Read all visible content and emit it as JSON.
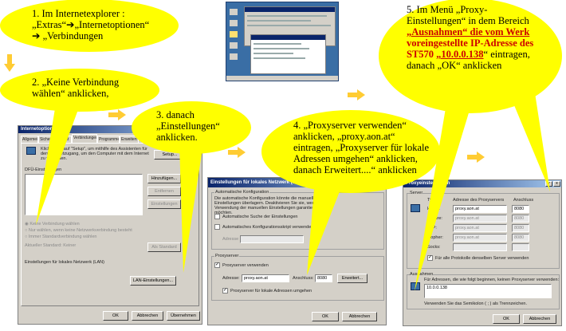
{
  "step1": {
    "line1": "1. Im Internetexplorer :",
    "line2": "„Extras“➔„Internetoptionen“",
    "line3": "➔ „Verbindungen"
  },
  "step2": {
    "line1": "2. „Keine Verbindung",
    "line2": "wählen“ anklicken,"
  },
  "step3": {
    "line1": "3. danach",
    "line2": "„Einstellungen“",
    "line3": "anklicken."
  },
  "step4": {
    "line1": "4. „Proxyserver verwenden“",
    "line2": "anklicken, „proxy.aon.at“",
    "line3": "eintragen, „Proxyserver für lokale",
    "line4": "Adressen umgehen“ anklicken,",
    "line5": "danach Erweitert....“ anklicken"
  },
  "step5": {
    "line1": "5. Im Menü „Proxy-",
    "line2": "Einstellungen“ in dem Bereich",
    "line3a": "„Ausnahmen“ die vom Werk",
    "line4a": "voreingestellte IP-Adresse des",
    "line5a": "ST570 ",
    "ip": "„10.0.0.138",
    "line5b": "“ eintragen,",
    "line6": "danach „OK“ anklicken"
  },
  "dialog1": {
    "title": "Internetoptionen",
    "tabs": [
      "Allgemein",
      "Sicherheit",
      "Inhalt",
      "Verbindungen",
      "Programme",
      "Erweitert"
    ],
    "setup_text": "Klicken Sie auf \"Setup\", um mithilfe des Assistenten für den Internetzugang, um den Computer mit dem Internet zu verbinden.",
    "setup_button": "Setup...",
    "dfue_label": "DFÜ-Einstellungen",
    "add_button": "Hinzufügen...",
    "remove_button": "Entfernen",
    "settings_button": "Einstellungen",
    "radio1": "Keine Verbindung wählen",
    "radio2": "Nur wählen, wenn keine Netzwerkverbindung besteht",
    "radio3": "Immer Standardverbindung wählen",
    "current_label": "Aktueller Standard: Keiner",
    "standard_button": "Als Standard",
    "lan_label": "Einstellungen für lokales Netzwerk (LAN)",
    "lan_button": "LAN-Einstellungen...",
    "ok": "OK",
    "cancel": "Abbrechen",
    "apply": "Übernehmen"
  },
  "dialog2": {
    "title": "Einstellungen für lokales Netzwerk (LAN)",
    "auto_group": "Automatische Konfiguration",
    "auto_text": "Die automatische Konfiguration könnte die manuellen Einstellungen überlagern. Deaktivieren Sie sie, wenn Sie die Verwendung der manuellen Einstellungen garantieren möchten.",
    "auto_detect": "Automatische Suche der Einstellungen",
    "auto_script": "Automatisches Konfigurationsskript verwenden",
    "address_label": "Adresse",
    "proxy_group": "Proxyserver",
    "use_proxy": "Proxyserver verwenden",
    "addr": "Adresse:",
    "proxy_value": "proxy.aon.at",
    "port_label": "Anschluss:",
    "port_value": "8080",
    "advanced_button": "Erweitert...",
    "bypass_local": "Proxyserver für lokale Adressen umgehen",
    "ok": "OK",
    "cancel": "Abbrechen"
  },
  "dialog3": {
    "title": "Proxyeinstellungen",
    "help": "?",
    "close": "x",
    "server_group": "Server",
    "col_type": "Typ",
    "col_addr": "Adresse des Proxyservers",
    "col_port": "Anschluss",
    "rows": [
      {
        "type": "HTTP:",
        "addr": "proxy.aon.at",
        "port": "8080"
      },
      {
        "type": "Secure:",
        "addr": "proxy.aon.at",
        "port": "8080"
      },
      {
        "type": "FTP:",
        "addr": "proxy.aon.at",
        "port": "8080"
      },
      {
        "type": "Gopher:",
        "addr": "proxy.aon.at",
        "port": "8080"
      },
      {
        "type": "Socks:",
        "addr": "",
        "port": ""
      }
    ],
    "same_proxy": "Für alle Protokolle denselben Server verwenden",
    "exceptions_group": "Ausnahmen",
    "exceptions_text": "Für Adressen, die wie folgt beginnen, keinen Proxyserver verwenden:",
    "exceptions_value": "10.0.0.138",
    "separator_hint": "Verwenden Sie das Semikolon ( ; ) als Trennzeichen.",
    "ok": "OK",
    "cancel": "Abbrechen"
  }
}
